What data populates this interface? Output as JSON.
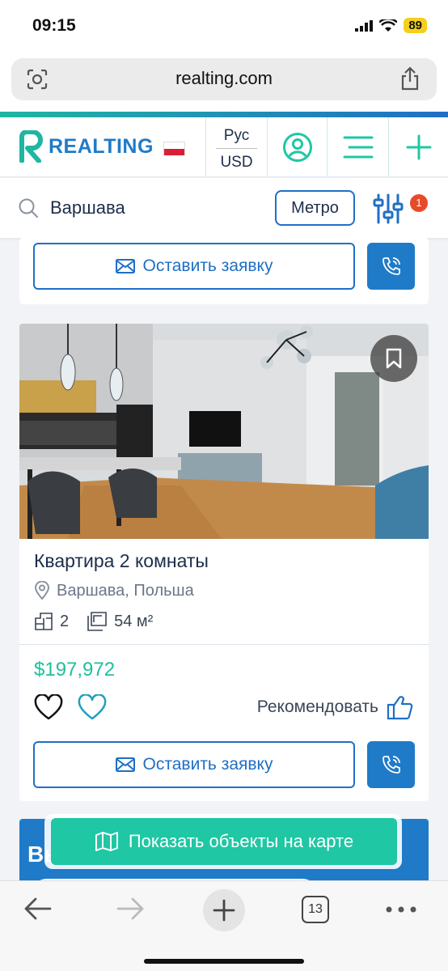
{
  "status_bar": {
    "time": "09:15",
    "battery": "89"
  },
  "browser": {
    "url": "realting.com",
    "tab_count": "13"
  },
  "header": {
    "brand": "REALTING",
    "language": "Рус",
    "currency": "USD"
  },
  "search": {
    "query": "Варшава",
    "metro_label": "Метро",
    "filter_badge": "1"
  },
  "top_card": {
    "request_label": "Оставить заявку"
  },
  "listing": {
    "title": "Квартира 2 комнаты",
    "location": "Варшава, Польша",
    "rooms": "2",
    "area": "54 м²",
    "price": "$197,972",
    "recommend_label": "Рекомендовать",
    "request_label": "Оставить заявку"
  },
  "banner": {
    "heading_partial": "Вы"
  },
  "map_button": {
    "label": "Показать объекты на карте"
  },
  "colors": {
    "brand_blue": "#1f6fc6",
    "teal": "#1ebf9b",
    "badge_red": "#e74b2a"
  }
}
